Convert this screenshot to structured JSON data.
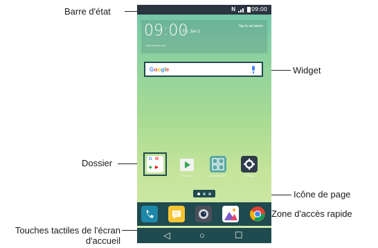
{
  "labels": {
    "status_bar": "Barre d'état",
    "widget": "Widget",
    "folder": "Dossier",
    "page_icon": "Icône de page",
    "quick_access": "Zone d'accès rapide",
    "home_touch_keys_line1": "Touches tactiles de l'écran",
    "home_touch_keys_line2": "d'accueil"
  },
  "status_bar": {
    "time": "09:00",
    "nfc": "N"
  },
  "clock_widget": {
    "time": "09:00",
    "date": "Fri, Jan 1",
    "alarm": "Tap to set alarm",
    "location": "Add location info"
  },
  "search_widget": {
    "logo": "Google"
  },
  "home_apps": [
    {
      "name": "Play Store",
      "icon": "play-store-icon"
    },
    {
      "name": "Management",
      "icon": "management-icon"
    },
    {
      "name": "Settings",
      "icon": "gear-icon"
    }
  ],
  "folder_apps": [
    "G",
    "M"
  ],
  "dock_apps": [
    {
      "icon": "phone-icon",
      "color": "#1e88a8"
    },
    {
      "icon": "message-icon",
      "color": "#f6c533"
    },
    {
      "icon": "camera-icon",
      "color": "#4a4f5a"
    },
    {
      "icon": "gallery-icon",
      "color": "#e5476a"
    },
    {
      "icon": "chrome-icon",
      "color": "#db4437"
    }
  ],
  "nav": {
    "back": "◁",
    "home": "○",
    "recents": "☐"
  },
  "colors": {
    "status_bar": "#2a3540",
    "dock": "#1f4a4f",
    "highlight_border": "#1f4a4f"
  }
}
